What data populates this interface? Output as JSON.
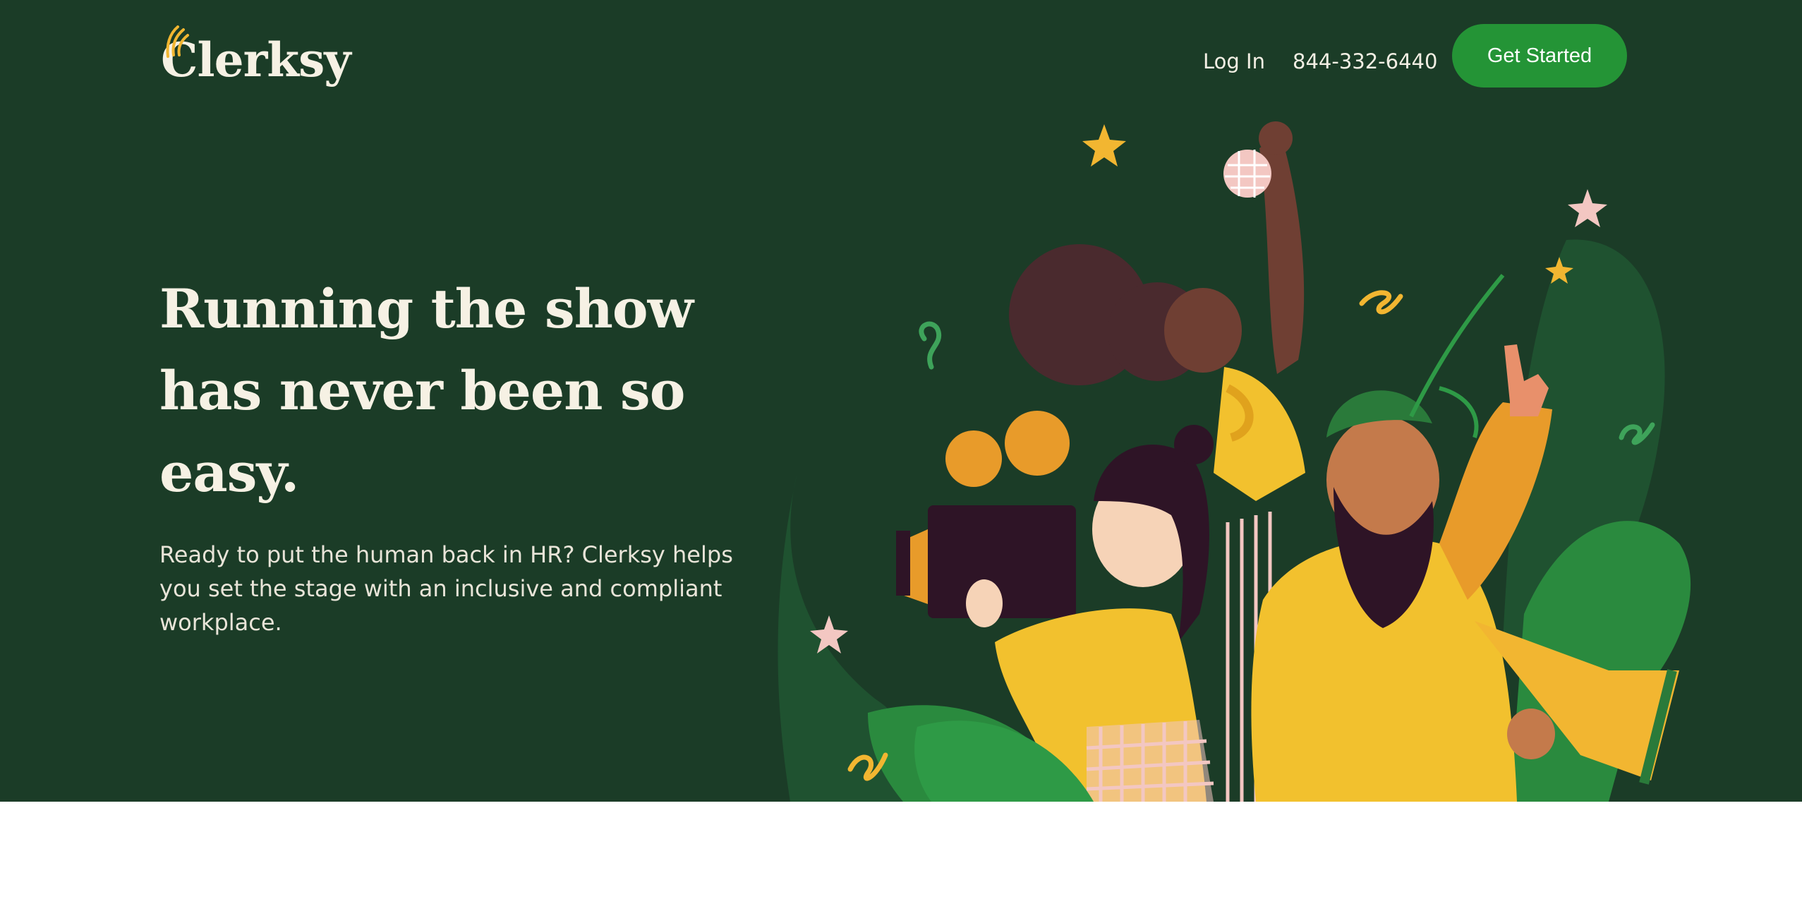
{
  "header": {
    "brand": "Clerksy",
    "nav": {
      "login_label": "Log In",
      "phone": "844-332-6440"
    },
    "cta_label": "Get Started"
  },
  "hero": {
    "headline": "Running the show has never been so easy.",
    "subtext": "Ready to put the human back in HR? Clerksy helps you set the stage with an inclusive and compliant workplace."
  },
  "colors": {
    "hero_background": "#1b3c27",
    "cta_background": "#249436",
    "text_light": "#f6f1e4",
    "accent_yellow": "#f2b631",
    "accent_pink": "#f3c7c2",
    "bright_green": "#2e9a46"
  },
  "illustration": {
    "icon": "film-crew-illustration"
  }
}
